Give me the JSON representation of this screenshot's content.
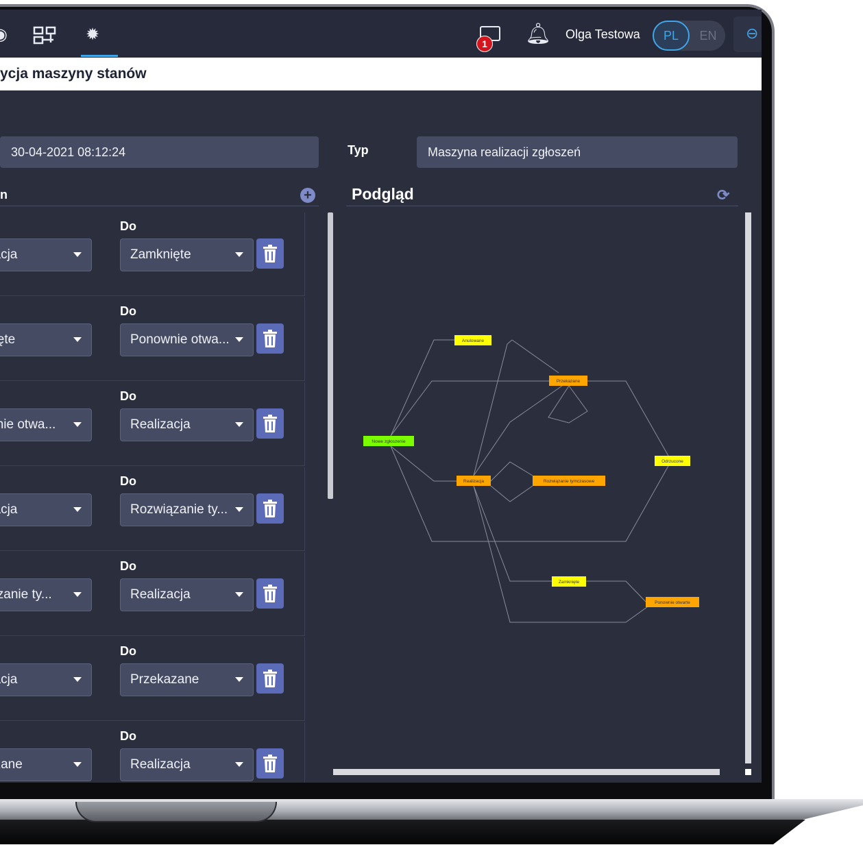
{
  "user": {
    "name": "Olga Testowa",
    "notifications_badge": "1"
  },
  "language": {
    "active": "PL",
    "inactive": "EN"
  },
  "nav": {
    "icons": [
      "home-icon",
      "diagram-icon",
      "gear-icon"
    ]
  },
  "page": {
    "title": "ycja maszyny stanów"
  },
  "form": {
    "date_value": "30-04-2021 08:12:24",
    "type_label": "Typ",
    "type_value": "Maszyna realizacji zgłoszeń"
  },
  "transitions": {
    "section_label": "n",
    "to_label": "Do",
    "rows": [
      {
        "from": "zacja",
        "to": "Zamknięte"
      },
      {
        "from": "nięte",
        "to": "Ponownie otwa..."
      },
      {
        "from": "wnie otwa...",
        "to": "Realizacja"
      },
      {
        "from": "zacja",
        "to": "Rozwiązanie ty..."
      },
      {
        "from": "iązanie ty...",
        "to": "Realizacja"
      },
      {
        "from": "zacja",
        "to": "Przekazane"
      },
      {
        "from": "azane",
        "to": "Realizacja"
      }
    ]
  },
  "preview": {
    "title": "Podgląd",
    "nodes": [
      {
        "id": "anulowane",
        "label": "Anulowane",
        "color": "#ffff00"
      },
      {
        "id": "przekazane",
        "label": "Przekazane",
        "color": "#ffa500"
      },
      {
        "id": "nowe",
        "label": "Nowe zgłoszenie",
        "color": "#7cfc00"
      },
      {
        "id": "odrzucone",
        "label": "Odrzucone",
        "color": "#ffff00"
      },
      {
        "id": "realizacja",
        "label": "Realizacja",
        "color": "#ffa500"
      },
      {
        "id": "rozwiazanie",
        "label": "Rozwiązanie tymczasowe",
        "color": "#ffa500"
      },
      {
        "id": "zamkniete",
        "label": "Zamknięte",
        "color": "#ffff00"
      },
      {
        "id": "ponownie",
        "label": "Ponownie otwarte",
        "color": "#ffa500"
      }
    ]
  }
}
